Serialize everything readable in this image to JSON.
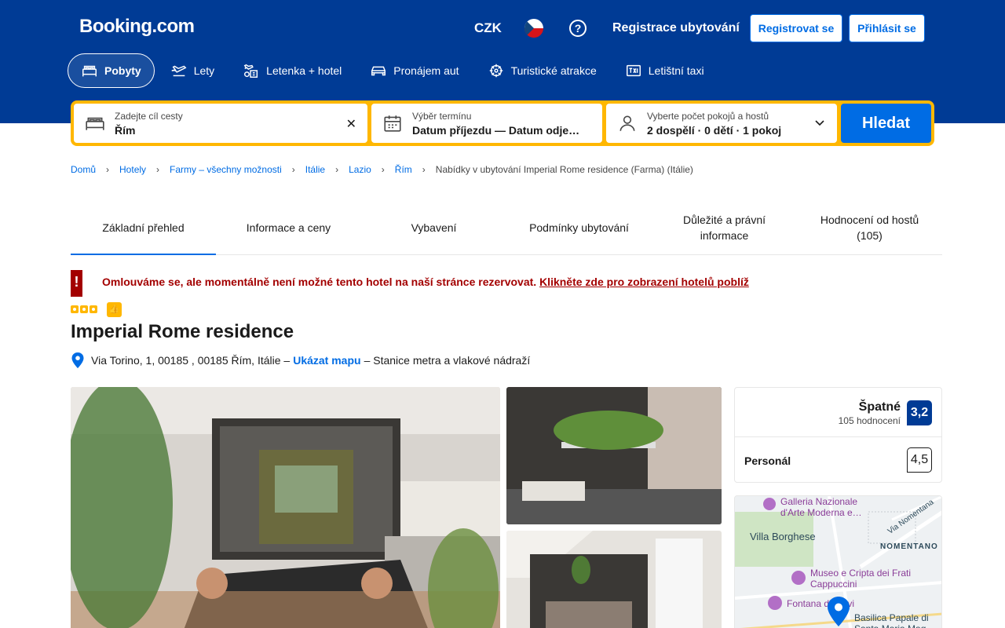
{
  "header": {
    "logo": "Booking.com",
    "currency": "CZK",
    "help": "?",
    "list_property": "Registrace ubytování",
    "register": "Registrovat se",
    "login": "Přihlásit se"
  },
  "nav_tabs": [
    {
      "label": "Pobyty",
      "icon": "bed-icon",
      "active": true
    },
    {
      "label": "Lety",
      "icon": "plane-icon"
    },
    {
      "label": "Letenka + hotel",
      "icon": "plane-hotel-icon"
    },
    {
      "label": "Pronájem aut",
      "icon": "car-icon"
    },
    {
      "label": "Turistické atrakce",
      "icon": "attractions-icon"
    },
    {
      "label": "Letištní taxi",
      "icon": "taxi-icon"
    }
  ],
  "search": {
    "dest_label": "Zadejte cíl cesty",
    "dest_value": "Řím",
    "dates_label": "Výběr termínu",
    "dates_value": "Datum příjezdu — Datum odje…",
    "guests_label": "Vyberte počet pokojů a hostů",
    "guests_value": "2 dospělí · 0 dětí · 1 pokoj",
    "button": "Hledat"
  },
  "breadcrumb": {
    "links": [
      "Domů",
      "Hotely",
      "Farmy – všechny možnosti",
      "Itálie",
      "Lazio",
      "Řím"
    ],
    "current": "Nabídky v ubytování Imperial Rome residence (Farma) (Itálie)"
  },
  "property_tabs": [
    {
      "label": "Základní přehled",
      "active": true
    },
    {
      "label": "Informace a ceny"
    },
    {
      "label": "Vybavení"
    },
    {
      "label": "Podmínky ubytování"
    },
    {
      "label": "Důležité a právní informace"
    },
    {
      "label": "Hodnocení od hostů (105)"
    }
  ],
  "alert": {
    "icon": "!",
    "text": "Omlouváme se, ale momentálně není možné tento hotel na naší stránce rezervovat.",
    "link": "Klikněte zde pro zobrazení hotelů poblíž"
  },
  "stars": 3,
  "hotel": {
    "name": "Imperial Rome residence",
    "address": "Via Torino, 1, 00185 , 00185 Řím, Itálie –",
    "map_link": "Ukázat mapu",
    "transport": "– Stanice metra a vlakové nádraží"
  },
  "rating": {
    "word": "Špatné",
    "count": "105 hodnocení",
    "score": "3,2",
    "staff_label": "Personál",
    "staff_score": "4,5"
  },
  "map": {
    "labels": [
      "Galleria Nazionale d'Arte Moderna e…",
      "Villa Borghese",
      "Via Nomentana",
      "NOMENTANO",
      "Museo e Cripta dei Frati Cappuccini",
      "Fontana di Trevi",
      "Basilica Papale di Santa Maria Mag…"
    ]
  },
  "colors": {
    "brand": "#003b95",
    "accent": "#006ce4",
    "search_border": "#ffb700",
    "alert": "#a30000"
  }
}
